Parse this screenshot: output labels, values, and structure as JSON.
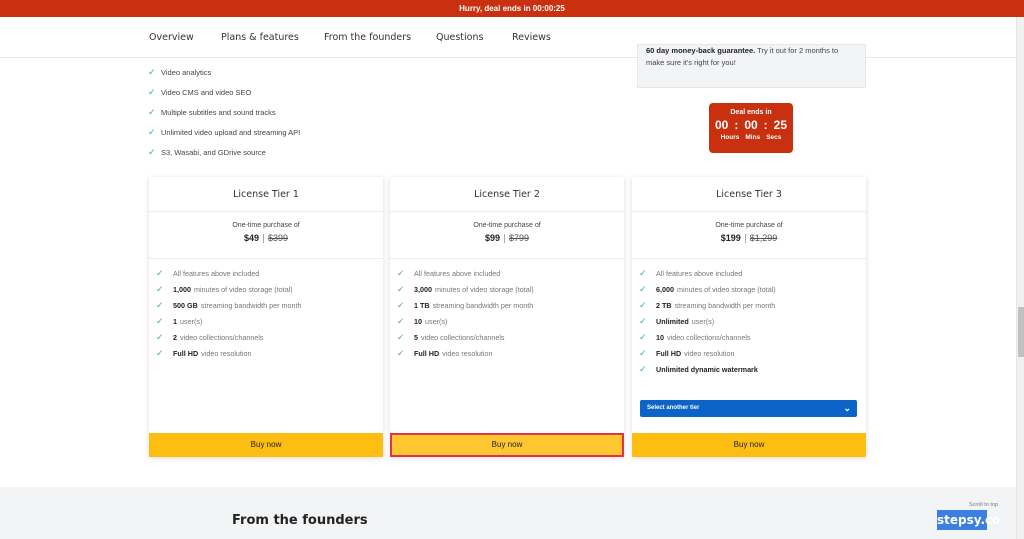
{
  "topbar": {
    "text": "Hurry, deal ends in 00:00:25"
  },
  "nav": {
    "items": [
      "Overview",
      "Plans & features",
      "From the founders",
      "Questions",
      "Reviews"
    ]
  },
  "features": [
    "Video analytics",
    "Video CMS and video SEO",
    "Multiple subtitles and sound tracks",
    "Unlimited video upload and streaming API",
    "S3, Wasabi, and GDrive source"
  ],
  "guarantee": {
    "bold": "60 day money-back guarantee.",
    "text": "Try it out for 2 months to make sure it's right for you!"
  },
  "deal": {
    "title": "Deal ends in",
    "hours": "00",
    "mins": "00",
    "secs": "25",
    "hours_label": "Hours",
    "mins_label": "Mins",
    "secs_label": "Secs",
    "sep": ":"
  },
  "tiers": [
    {
      "title": "License Tier 1",
      "pre": "One-time purchase of",
      "price": "$49",
      "old_price": "$399",
      "items": [
        {
          "bold": "",
          "text": "All features above included"
        },
        {
          "bold": "1,000",
          "text": "minutes of video storage (total)"
        },
        {
          "bold": "500 GB",
          "text": "streaming bandwidth per month"
        },
        {
          "bold": "1",
          "text": "user(s)"
        },
        {
          "bold": "2",
          "text": "video collections/channels"
        },
        {
          "bold": "Full HD",
          "text": "video resolution"
        }
      ],
      "buy_label": "Buy now"
    },
    {
      "title": "License Tier 2",
      "pre": "One-time purchase of",
      "price": "$99",
      "old_price": "$799",
      "items": [
        {
          "bold": "",
          "text": "All features above included"
        },
        {
          "bold": "3,000",
          "text": "minutes of video storage (total)"
        },
        {
          "bold": "1 TB",
          "text": "streaming bandwidth per month"
        },
        {
          "bold": "10",
          "text": "user(s)"
        },
        {
          "bold": "5",
          "text": "video collections/channels"
        },
        {
          "bold": "Full HD",
          "text": "video resolution"
        }
      ],
      "buy_label": "Buy now"
    },
    {
      "title": "License Tier 3",
      "pre": "One-time purchase of",
      "price": "$199",
      "old_price": "$1,299",
      "items": [
        {
          "bold": "",
          "text": "All features above included"
        },
        {
          "bold": "6,000",
          "text": "minutes of video storage (total)"
        },
        {
          "bold": "2 TB",
          "text": "streaming bandwidth per month"
        },
        {
          "bold": "Unlimited",
          "text": "user(s)"
        },
        {
          "bold": "10",
          "text": "video collections/channels"
        },
        {
          "bold": "Full HD",
          "text": "video resolution"
        },
        {
          "bold": "Unlimited dynamic watermark",
          "text": ""
        }
      ],
      "select_label": "Select another tier",
      "buy_label": "Buy now"
    }
  ],
  "founders": {
    "title": "From the founders"
  },
  "scroll_top": "Scroll to top",
  "watermark": "stepsy.co",
  "colors": {
    "accent_red": "#c8300f",
    "buy_yellow": "#fdbd11",
    "select_blue": "#0c63c8",
    "check_green": "#3cb371"
  }
}
